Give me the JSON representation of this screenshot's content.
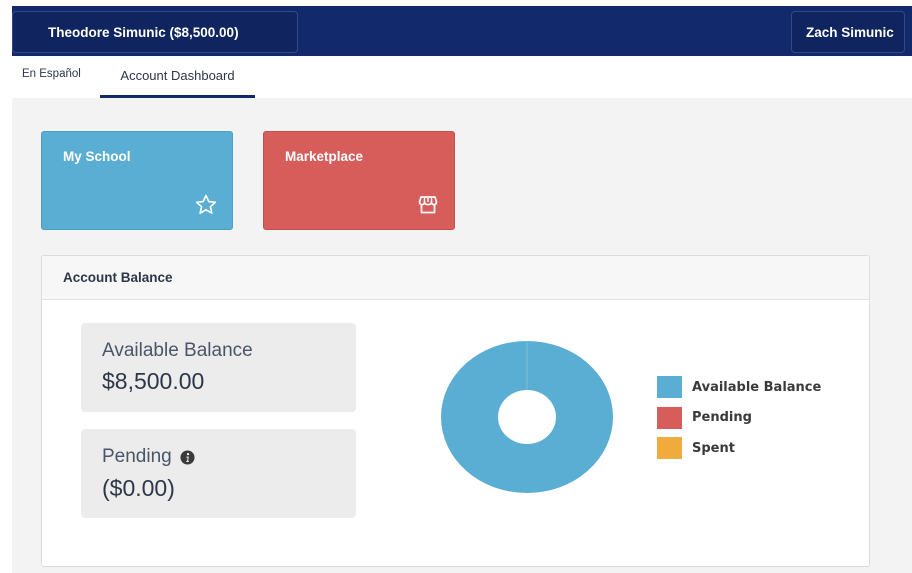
{
  "header": {
    "account_selector": "Theodore Simunic ($8,500.00)",
    "user_button": "Zach Simunic"
  },
  "tabs": {
    "espanol": "En Español",
    "dashboard": "Account Dashboard"
  },
  "tiles": [
    {
      "label": "My School",
      "color": "#5aaed3",
      "icon": "star-icon"
    },
    {
      "label": "Marketplace",
      "color": "#d75d5b",
      "icon": "storefront-icon"
    }
  ],
  "account_balance": {
    "title": "Account Balance",
    "available_label": "Available Balance",
    "available_value": "$8,500.00",
    "pending_label": "Pending",
    "pending_value": "($0.00)"
  },
  "chart_data": {
    "type": "pie",
    "categories": [
      "Available Balance",
      "Pending",
      "Spent"
    ],
    "values": [
      8500,
      0,
      0
    ],
    "colors": [
      "#5aaed3",
      "#d75d5b",
      "#efab3c"
    ],
    "donut": true,
    "legend_position": "right"
  }
}
